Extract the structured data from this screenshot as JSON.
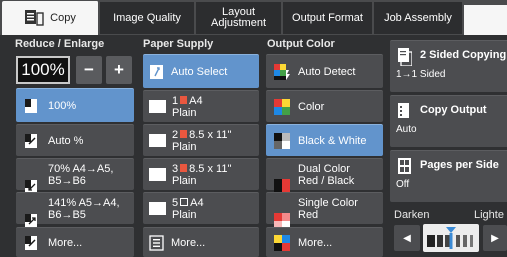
{
  "tabs": [
    {
      "label": "Copy",
      "active": true,
      "icon": "copy-icon"
    },
    {
      "label": "Image Quality",
      "active": false
    },
    {
      "label": "Layout\nAdjustment",
      "active": false
    },
    {
      "label": "Output Format",
      "active": false
    },
    {
      "label": "Job Assembly",
      "active": false
    }
  ],
  "reduce_enlarge": {
    "heading": "Reduce / Enlarge",
    "value": "100%",
    "minus": "−",
    "plus": "+",
    "options": [
      {
        "label": "100%",
        "selected": true
      },
      {
        "label": "Auto %",
        "selected": false
      },
      {
        "label": "70% A4→A5,\nB5→B6",
        "selected": false
      },
      {
        "label": "141% A5→A4,\nB6→B5",
        "selected": false
      },
      {
        "label": "More...",
        "selected": false
      }
    ]
  },
  "paper_supply": {
    "heading": "Paper Supply",
    "options": [
      {
        "label": "Auto Select",
        "selected": true
      },
      {
        "tray": "1",
        "size": "A4",
        "type": "Plain"
      },
      {
        "tray": "2",
        "size": "8.5 x 11\"",
        "type": "Plain"
      },
      {
        "tray": "3",
        "size": "8.5 x 11\"",
        "type": "Plain"
      },
      {
        "tray": "5",
        "size": "A4",
        "type": "Plain"
      },
      {
        "label": "More..."
      }
    ]
  },
  "output_color": {
    "heading": "Output Color",
    "options": [
      {
        "label": "Auto Detect",
        "selected": false
      },
      {
        "label": "Color",
        "selected": false
      },
      {
        "label": "Black & White",
        "selected": true
      },
      {
        "label": "Dual Color\nRed / Black",
        "selected": false
      },
      {
        "label": "Single Color\nRed",
        "selected": false
      },
      {
        "label": "More...",
        "selected": false
      }
    ]
  },
  "right_panel": {
    "two_sided": {
      "title": "2 Sided Copying",
      "value": "1→1 Sided"
    },
    "copy_output": {
      "title": "Copy Output",
      "value": "Auto"
    },
    "pages_per_side": {
      "title": "Pages per Side",
      "value": "Off"
    },
    "darken_label": "Darken",
    "lighten_label": "Lighte",
    "darkness_level": 0.5
  },
  "colors": {
    "selected": "#6294cc",
    "button": "#4c4d50",
    "background": "#2f3032"
  }
}
